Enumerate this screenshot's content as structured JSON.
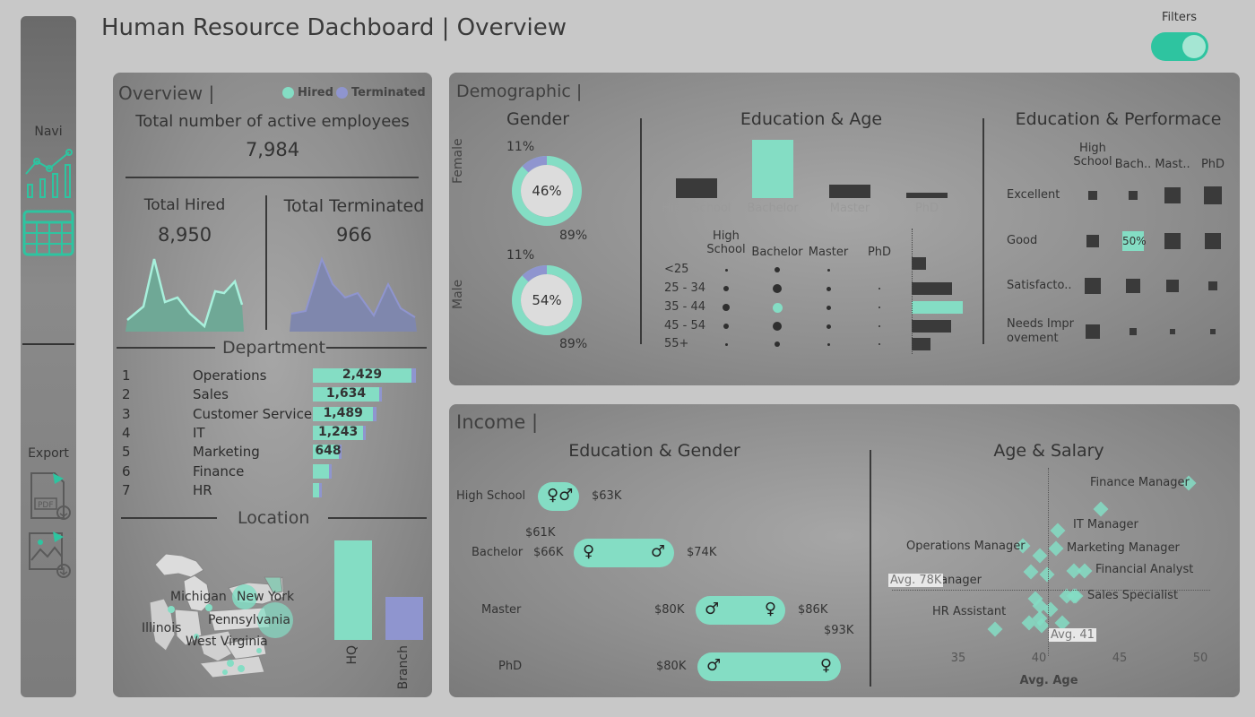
{
  "header": {
    "title": "Human Resource Dachboard | Overview",
    "filters_label": "Filters"
  },
  "sidebar": {
    "navi_label": "Navi",
    "export_label": "Export"
  },
  "overview": {
    "title": "Overview |",
    "legend": {
      "hired": "Hired",
      "terminated": "Terminated"
    },
    "active_label": "Total number of active employees",
    "active_value": "7,984",
    "hired_label": "Total Hired",
    "hired_value": "8,950",
    "terminated_label": "Total Terminated",
    "terminated_value": "966",
    "department_title": "Department",
    "departments": [
      {
        "rank": "1",
        "name": "Operations",
        "value": "2,429",
        "hired": 2429,
        "terminated": 260
      },
      {
        "rank": "2",
        "name": "Sales",
        "value": "1,634",
        "hired": 1634,
        "terminated": 170
      },
      {
        "rank": "3",
        "name": "Customer Service",
        "value": "1,489",
        "hired": 1489,
        "terminated": 160
      },
      {
        "rank": "4",
        "name": "IT",
        "value": "1,243",
        "hired": 1243,
        "terminated": 130
      },
      {
        "rank": "5",
        "name": "Marketing",
        "value": "648",
        "hired": 648,
        "terminated": 60
      },
      {
        "rank": "6",
        "name": "Finance",
        "value": "",
        "hired": 400,
        "terminated": 30
      },
      {
        "rank": "7",
        "name": "HR",
        "value": "",
        "hired": 150,
        "terminated": 10
      }
    ],
    "location_title": "Location",
    "map_labels": {
      "michigan": "Michigan",
      "new_york": "New York",
      "pennsylvania": "Pennsylvania",
      "illinois": "Illinois",
      "west_virginia": "West Virginia"
    },
    "location_bars": [
      {
        "label": "HQ",
        "value": 100
      },
      {
        "label": "Branch",
        "value": 43
      }
    ]
  },
  "demographic": {
    "title": "Demographic |",
    "gender_title": "Gender",
    "female_label": "Female",
    "male_label": "Male",
    "female": {
      "center": "46%",
      "top": "11%",
      "bottom": "89%"
    },
    "male": {
      "center": "54%",
      "top": "11%",
      "bottom": "89%"
    },
    "edu_age_title": "Education & Age",
    "edu_levels": [
      "High School",
      "Bachelor",
      "Master",
      "PhD"
    ],
    "edu_bar_values": [
      22,
      65,
      15,
      6
    ],
    "edu_cols": [
      "High\nSchool",
      "Bachelor",
      "Master",
      "PhD"
    ],
    "age_groups": [
      "<25",
      "25 - 34",
      "35 - 44",
      "45 - 54",
      "55+"
    ],
    "age_bar_values": [
      16,
      45,
      57,
      44,
      21
    ],
    "edu_perf_title": "Education & Performace",
    "perf_cols": [
      "High\nSchool",
      "Bach..",
      "Mast..",
      "PhD"
    ],
    "perf_rows": [
      "Excellent",
      "Good",
      "Satisfacto..",
      "Needs Impr\novement"
    ],
    "perf_highlight": "50%"
  },
  "income": {
    "title": "Income |",
    "edu_gender_title": "Education & Gender",
    "rows": [
      {
        "label": "High School",
        "left": "",
        "right": "$63K",
        "extra": ""
      },
      {
        "label": "Bachelor",
        "left": "$66K",
        "right": "$74K",
        "extra": "$61K"
      },
      {
        "label": "Master",
        "left": "$80K",
        "right": "$86K",
        "extra": "$93K"
      },
      {
        "label": "PhD",
        "left": "$80K",
        "right": "",
        "extra": ""
      }
    ],
    "age_salary_title": "Age & Salary",
    "scatter_labels": [
      "Finance Manager",
      "IT Manager",
      "Operations Manager",
      "Marketing Manager",
      "Financial Analyst",
      "HR Manager",
      "Sales Specialist",
      "HR Assistant"
    ],
    "avg_salary_label": "Avg. 78K",
    "avg_age_label": "Avg. 41",
    "x_ticks": [
      "35",
      "40",
      "45",
      "50"
    ],
    "x_label": "Avg. Age"
  },
  "colors": {
    "hired": "#84ddc4",
    "terminated": "#8f95cf",
    "toggle": "#2ec4a0"
  }
}
